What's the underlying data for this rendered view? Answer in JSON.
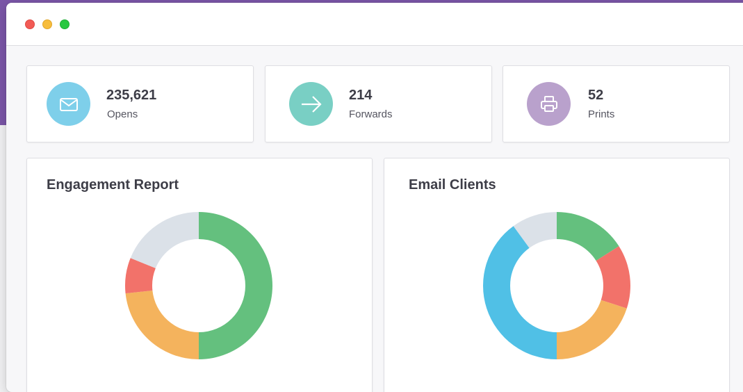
{
  "stats": [
    {
      "value": "235,621",
      "label": "Opens",
      "icon": "envelope-icon",
      "color": "#7ecfea"
    },
    {
      "value": "214",
      "label": "Forwards",
      "icon": "arrow-right-icon",
      "color": "#79cfc4"
    },
    {
      "value": "52",
      "label": "Prints",
      "icon": "printer-icon",
      "color": "#b9a1cc"
    }
  ],
  "engagement": {
    "title": "Engagement Report",
    "chart_data": {
      "type": "pie",
      "donut": true,
      "slices": [
        {
          "value": 45,
          "color": "#64c07e"
        },
        {
          "value": 21,
          "color": "#f4b35d"
        },
        {
          "value": 7,
          "color": "#f2726a"
        },
        {
          "value": 17,
          "color": "#dbe1e8"
        }
      ]
    }
  },
  "email_clients": {
    "title": "Email Clients",
    "chart_data": {
      "type": "pie",
      "donut": true,
      "slices": [
        {
          "value": 16,
          "color": "#64c07e"
        },
        {
          "value": 14,
          "color": "#f2726a"
        },
        {
          "value": 20,
          "color": "#f4b35d"
        },
        {
          "value": 40,
          "color": "#50c0e6"
        },
        {
          "value": 10,
          "color": "#dbe1e8"
        }
      ]
    }
  }
}
